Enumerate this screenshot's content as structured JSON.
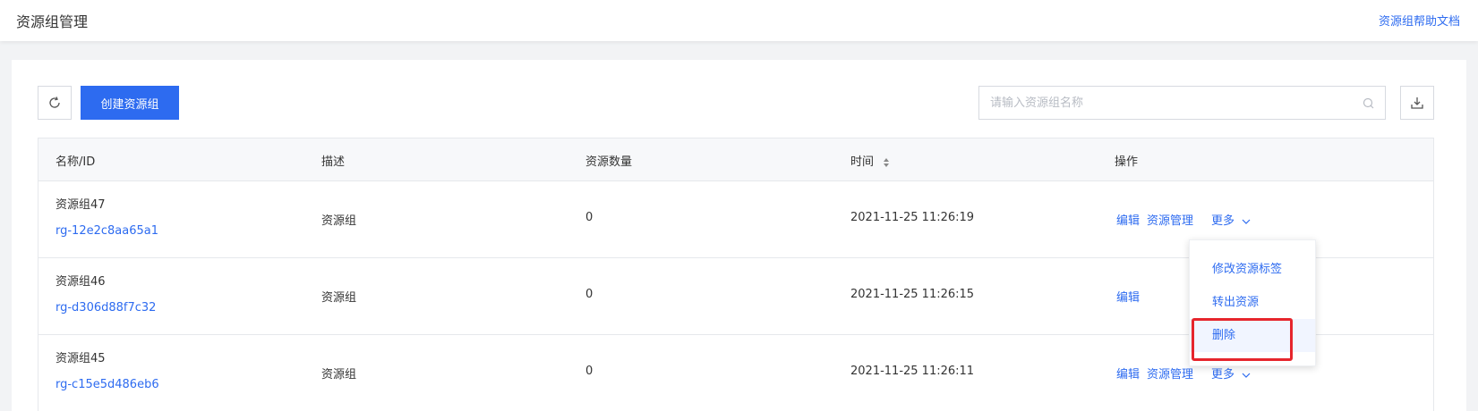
{
  "header": {
    "title": "资源组管理",
    "help_link": "资源组帮助文档"
  },
  "toolbar": {
    "create_label": "创建资源组",
    "search_placeholder": "请输入资源组名称"
  },
  "table": {
    "columns": [
      "名称/ID",
      "描述",
      "资源数量",
      "时间",
      "操作"
    ],
    "rows": [
      {
        "name": "资源组47",
        "id": "rg-12e2c8aa65a1",
        "desc": "资源组",
        "count": "0",
        "time": "2021-11-25 11:26:19",
        "edit": "编辑",
        "manage": "资源管理",
        "more": "更多"
      },
      {
        "name": "资源组46",
        "id": "rg-d306d88f7c32",
        "desc": "资源组",
        "count": "0",
        "time": "2021-11-25 11:26:15",
        "edit": "编辑",
        "manage": "",
        "more": ""
      },
      {
        "name": "资源组45",
        "id": "rg-c15e5d486eb6",
        "desc": "资源组",
        "count": "0",
        "time": "2021-11-25 11:26:11",
        "edit": "编辑",
        "manage": "资源管理",
        "more": "更多"
      }
    ]
  },
  "dropdown": {
    "items": [
      "修改资源标签",
      "转出资源",
      "删除"
    ]
  },
  "colors": {
    "primary": "#2d6bf0",
    "highlight": "#e6252c"
  }
}
